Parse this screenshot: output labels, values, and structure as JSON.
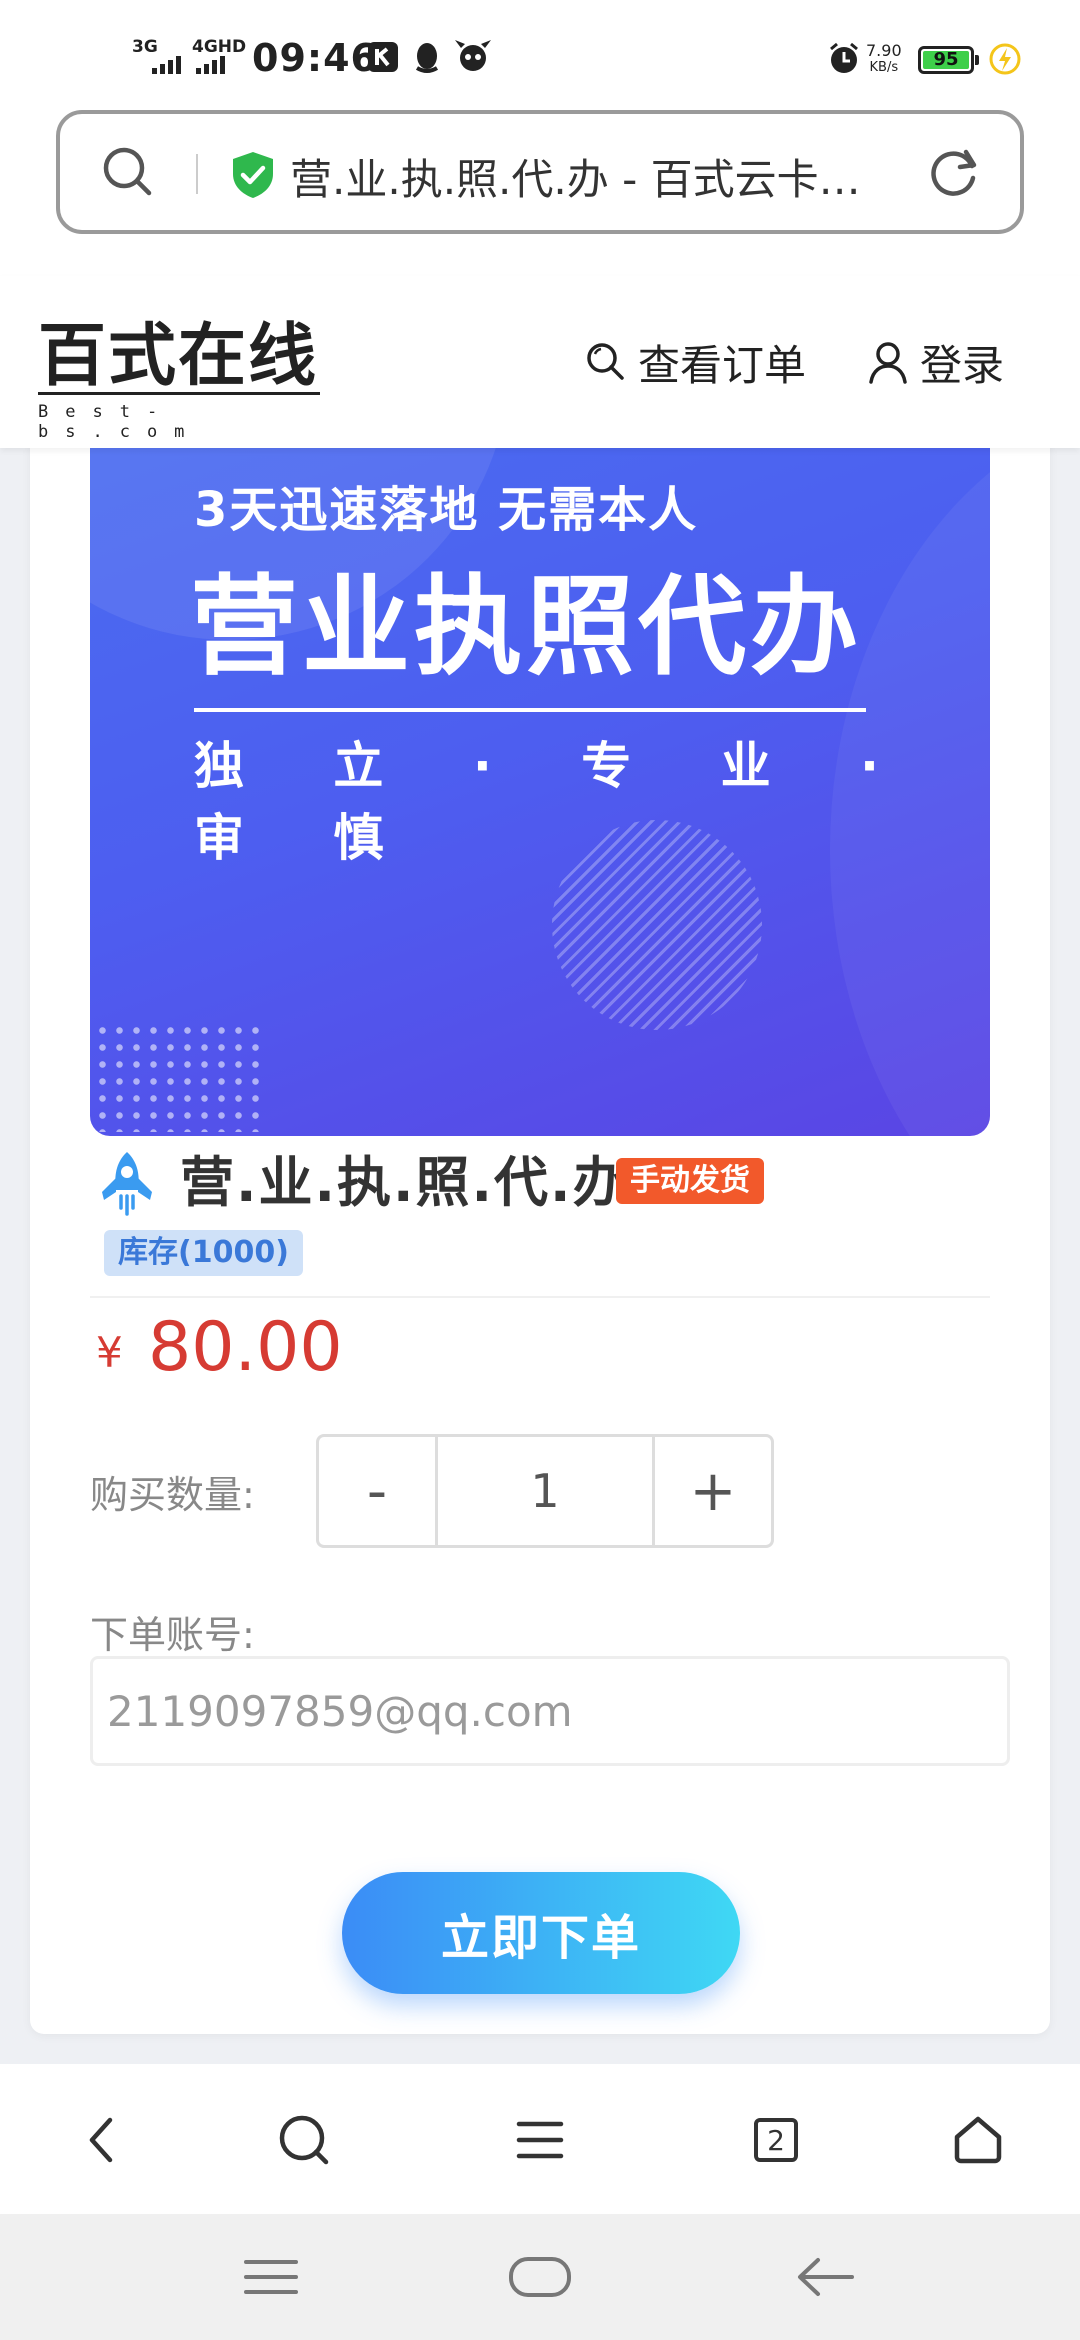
{
  "status_bar": {
    "network_1": "3G",
    "network_2": "4GHD",
    "time": "09:46",
    "net_speed_value": "7.90",
    "net_speed_unit": "KB/s",
    "battery": "95"
  },
  "browser": {
    "address_title": "营.业.执.照.代.办 - 百式云卡…",
    "tab_count": "2"
  },
  "site": {
    "logo_main": "百式在线",
    "logo_sub": "Best-bs.com",
    "nav_orders": "查看订单",
    "nav_login": "登录"
  },
  "banner": {
    "line1": "3天迅速落地  无需本人",
    "line2": "营业执照代办",
    "line3": "独 立 · 专 业 · 审 慎"
  },
  "product": {
    "title": "营.业.执.照.代.办",
    "badge": "手动发货",
    "stock": "库存(1000)",
    "currency": "¥",
    "price": "80.00",
    "qty_label": "购买数量:",
    "qty_minus": "-",
    "qty_value": "1",
    "qty_plus": "+",
    "account_label": "下单账号:",
    "account_placeholder": "2119097859@qq.com",
    "order_button": "立即下单"
  },
  "colors": {
    "price": "#d63b33",
    "badge": "#f2592b",
    "stock_bg": "#cfe1f8",
    "banner": "#4d5ef0",
    "button_start": "#3b8cf6",
    "button_end": "#3fd8f4"
  }
}
